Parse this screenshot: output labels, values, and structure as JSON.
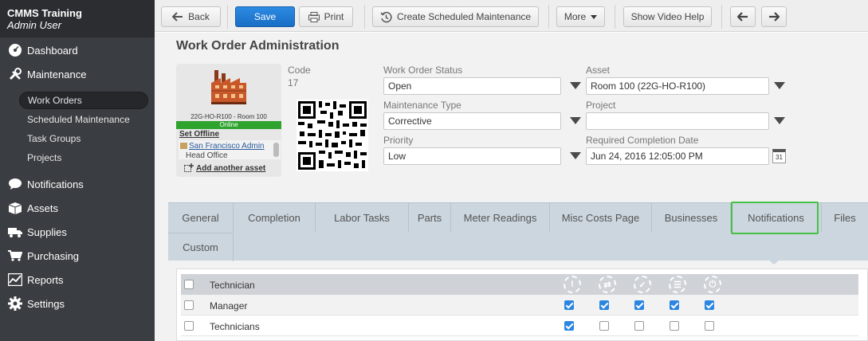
{
  "brand": {
    "title": "CMMS Training",
    "user": "Admin User"
  },
  "nav": {
    "dashboard": "Dashboard",
    "maintenance": "Maintenance",
    "work_orders": "Work Orders",
    "scheduled_maintenance": "Scheduled Maintenance",
    "task_groups": "Task Groups",
    "projects": "Projects",
    "notifications": "Notifications",
    "assets": "Assets",
    "supplies": "Supplies",
    "purchasing": "Purchasing",
    "reports": "Reports",
    "settings": "Settings"
  },
  "toolbar": {
    "back": "Back",
    "save": "Save",
    "print": "Print",
    "create_scheduled": "Create Scheduled Maintenance",
    "more": "More",
    "video_help": "Show Video Help"
  },
  "page": {
    "title": "Work Order Administration"
  },
  "asset_card": {
    "caption": "22G-HO-R100 - Room 100",
    "status": "Online",
    "set_offline": "Set Offline",
    "location": "San Francisco Admin",
    "sublocation": "Head Office",
    "add_asset": "Add another asset"
  },
  "form": {
    "code_label": "Code",
    "code_value": "17",
    "status_label": "Work Order Status",
    "status_value": "Open",
    "asset_label": "Asset",
    "asset_value": "Room 100 (22G-HO-R100)",
    "type_label": "Maintenance Type",
    "type_value": "Corrective",
    "project_label": "Project",
    "project_value": "",
    "priority_label": "Priority",
    "priority_value": "Low",
    "date_label": "Required Completion Date",
    "date_value": "Jun 24, 2016 12:05:00 PM",
    "calendar_glyph": "31"
  },
  "tabs": [
    "General",
    "Completion",
    "Labor Tasks",
    "Parts",
    "Meter Readings",
    "Misc Costs Page",
    "Businesses",
    "Notifications",
    "Files",
    "Custom"
  ],
  "active_tab": "Notifications",
  "notifications_table": {
    "header": "Technician",
    "rows": [
      {
        "name": "Manager",
        "checks": [
          true,
          true,
          true,
          true,
          true
        ]
      },
      {
        "name": "Technicians",
        "checks": [
          true,
          false,
          false,
          false,
          false
        ]
      }
    ]
  },
  "colors": {
    "accent": "#1a6dc4",
    "highlight": "#45c245",
    "online": "#2ea32e"
  }
}
